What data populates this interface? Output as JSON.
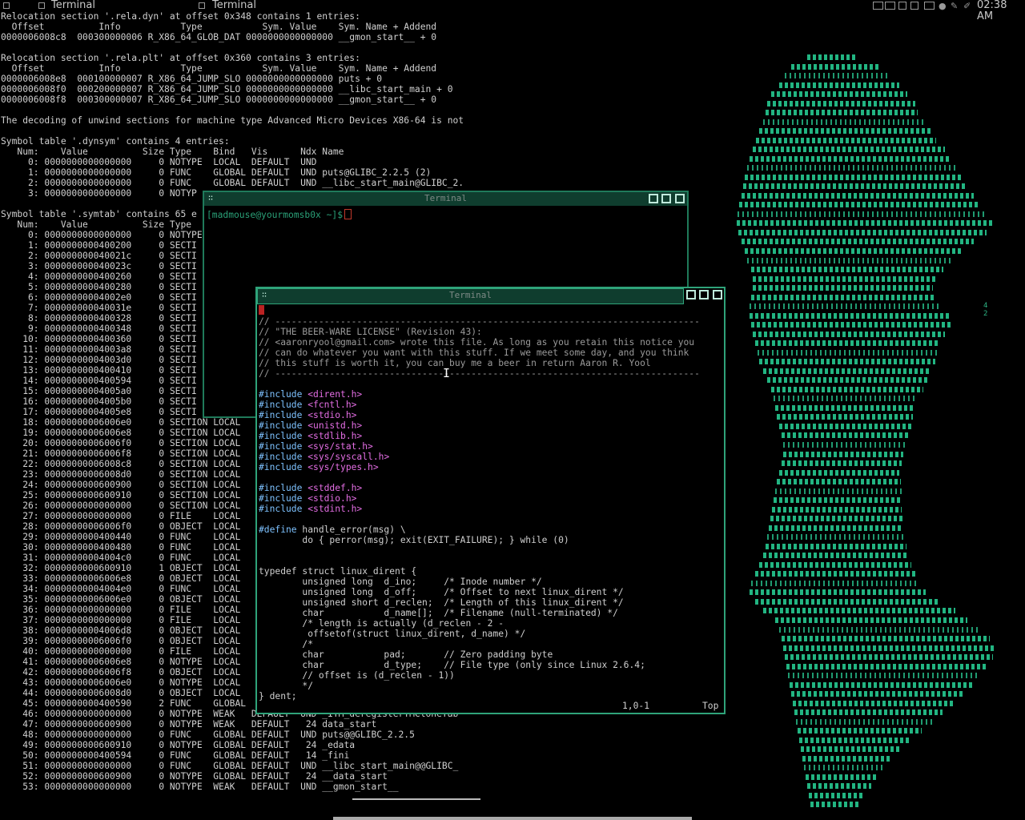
{
  "taskbar": {
    "task1_title": "Terminal",
    "task2_title": "Terminal",
    "clock": "02:38 AM"
  },
  "background_terminal": {
    "lines": [
      "Relocation section '.rela.dyn' at offset 0x348 contains 1 entries:",
      "  Offset          Info           Type           Sym. Value    Sym. Name + Addend",
      "0000006008c8  000300000006 R_X86_64_GLOB_DAT 0000000000000000 __gmon_start__ + 0",
      "",
      "Relocation section '.rela.plt' at offset 0x360 contains 3 entries:",
      "  Offset          Info           Type           Sym. Value    Sym. Name + Addend",
      "0000006008e8  000100000007 R_X86_64_JUMP_SLO 0000000000000000 puts + 0",
      "0000006008f0  000200000007 R_X86_64_JUMP_SLO 0000000000000000 __libc_start_main + 0",
      "0000006008f8  000300000007 R_X86_64_JUMP_SLO 0000000000000000 __gmon_start__ + 0",
      "",
      "The decoding of unwind sections for machine type Advanced Micro Devices X86-64 is not",
      "",
      "Symbol table '.dynsym' contains 4 entries:",
      "   Num:    Value          Size Type    Bind   Vis      Ndx Name",
      "     0: 0000000000000000     0 NOTYPE  LOCAL  DEFAULT  UND",
      "     1: 0000000000000000     0 FUNC    GLOBAL DEFAULT  UND puts@GLIBC_2.2.5 (2)",
      "     2: 0000000000000000     0 FUNC    GLOBAL DEFAULT  UND __libc_start_main@GLIBC_2.",
      "     3: 0000000000000000     0 NOTYP",
      "",
      "Symbol table '.symtab' contains 65 e",
      "   Num:    Value          Size Type",
      "     0: 0000000000000000     0 NOTYPE",
      "     1: 0000000000400200     0 SECTI",
      "     2: 000000000040021c     0 SECTI",
      "     3: 000000000040023c     0 SECTI",
      "     4: 0000000000400260     0 SECTI",
      "     5: 0000000000400280     0 SECTI",
      "     6: 00000000004002e0     0 SECTI",
      "     7: 000000000040031e     0 SECTI",
      "     8: 0000000000400328     0 SECTI",
      "     9: 0000000000400348     0 SECTI",
      "    10: 0000000000400360     0 SECTI",
      "    11: 00000000004003a8     0 SECTI",
      "    12: 00000000004003d0     0 SECTI",
      "    13: 0000000000400410     0 SECTI",
      "    14: 0000000000400594     0 SECTI",
      "    15: 00000000004005a0     0 SECTI",
      "    16: 00000000004005b0     0 SECTI",
      "    17: 00000000004005e8     0 SECTI",
      "    18: 00000000006006e0     0 SECTION LOCAL",
      "    19: 00000000006006e8     0 SECTION LOCAL",
      "    20: 00000000006006f0     0 SECTION LOCAL",
      "    21: 00000000006006f8     0 SECTION LOCAL",
      "    22: 00000000006008c8     0 SECTION LOCAL",
      "    23: 00000000006008d0     0 SECTION LOCAL",
      "    24: 0000000000600900     0 SECTION LOCAL",
      "    25: 0000000000600910     0 SECTION LOCAL",
      "    26: 0000000000000000     0 SECTION LOCAL",
      "    27: 0000000000000000     0 FILE    LOCAL",
      "    28: 00000000006006f0     0 OBJECT  LOCAL",
      "    29: 0000000000400440     0 FUNC    LOCAL",
      "    30: 0000000000400480     0 FUNC    LOCAL",
      "    31: 00000000004004c0     0 FUNC    LOCAL",
      "    32: 0000000000600910     1 OBJECT  LOCAL",
      "    33: 00000000006006e8     0 OBJECT  LOCAL",
      "    34: 00000000004004e0     0 FUNC    LOCAL",
      "    35: 00000000006006e0     0 OBJECT  LOCAL",
      "    36: 0000000000000000     0 FILE    LOCAL",
      "    37: 0000000000000000     0 FILE    LOCAL",
      "    38: 00000000004006d8     0 OBJECT  LOCAL",
      "    39: 00000000006006f0     0 OBJECT  LOCAL",
      "    40: 0000000000000000     0 FILE    LOCAL",
      "    41: 00000000006006e8     0 NOTYPE  LOCAL",
      "    42: 00000000006006f8     0 OBJECT  LOCAL",
      "    43: 00000000006006e0     0 NOTYPE  LOCAL",
      "    44: 00000000006008d0     0 OBJECT  LOCAL",
      "    45: 0000000000400590     2 FUNC    GLOBAL",
      "    46: 0000000000000000     0 NOTYPE  WEAK   DEFAULT  UND _ITM_deregisterTMCloneTab",
      "    47: 0000000000600900     0 NOTYPE  WEAK   DEFAULT   24 data_start",
      "    48: 0000000000000000     0 FUNC    GLOBAL DEFAULT  UND puts@@GLIBC_2.2.5",
      "    49: 0000000000600910     0 NOTYPE  GLOBAL DEFAULT   24 _edata",
      "    50: 0000000000400594     0 FUNC    GLOBAL DEFAULT   14 _fini",
      "    51: 0000000000000000     0 FUNC    GLOBAL DEFAULT  UND __libc_start_main@@GLIBC_",
      "    52: 0000000000600900     0 NOTYPE  GLOBAL DEFAULT   24 __data_start",
      "    53: 0000000000000000     0 NOTYPE  WEAK   DEFAULT  UND __gmon_start__"
    ]
  },
  "ascii_art": {
    "color": "#22b582",
    "labels": [
      "4",
      "2"
    ]
  },
  "terminal_back": {
    "title": "Terminal",
    "prompt": "[madmouse@yourmomsb0x ~]$"
  },
  "terminal_front": {
    "title": "Terminal",
    "code_lines": [
      {
        "cls": "",
        "text": ""
      },
      {
        "cls": "c-com",
        "text": "// ------------------------------------------------------------------------------"
      },
      {
        "cls": "c-com",
        "text": "// \"THE BEER-WARE LICENSE\" (Revision 43):"
      },
      {
        "cls": "c-com",
        "text": "// <aaronryool@gmail.com> wrote this file. As long as you retain this notice you"
      },
      {
        "cls": "c-com",
        "text": "// can do whatever you want with this stuff. If we meet some day, and you think"
      },
      {
        "cls": "c-com",
        "text": "// this stuff is worth it, you can buy me a beer in return Aaron R. Yool"
      },
      {
        "cls": "c-com",
        "text": "// ------------------------------------------------------------------------------"
      },
      {
        "cls": "",
        "text": ""
      },
      {
        "cls": "inc",
        "pp": "#include",
        "arg": "<dirent.h>"
      },
      {
        "cls": "inc",
        "pp": "#include",
        "arg": "<fcntl.h>"
      },
      {
        "cls": "inc",
        "pp": "#include",
        "arg": "<stdio.h>"
      },
      {
        "cls": "inc",
        "pp": "#include",
        "arg": "<unistd.h>"
      },
      {
        "cls": "inc",
        "pp": "#include",
        "arg": "<stdlib.h>"
      },
      {
        "cls": "inc",
        "pp": "#include",
        "arg": "<sys/stat.h>"
      },
      {
        "cls": "inc",
        "pp": "#include",
        "arg": "<sys/syscall.h>"
      },
      {
        "cls": "inc",
        "pp": "#include",
        "arg": "<sys/types.h>"
      },
      {
        "cls": "",
        "text": ""
      },
      {
        "cls": "inc",
        "pp": "#include",
        "arg": "<stddef.h>"
      },
      {
        "cls": "inc",
        "pp": "#include",
        "arg": "<stdio.h>"
      },
      {
        "cls": "inc",
        "pp": "#include",
        "arg": "<stdint.h>"
      },
      {
        "cls": "",
        "text": ""
      },
      {
        "cls": "def",
        "pp": "#define",
        "arg": " handle_error(msg) \\"
      },
      {
        "cls": "",
        "text": "        do { perror(msg); exit(EXIT_FAILURE); } while (0)"
      },
      {
        "cls": "",
        "text": ""
      },
      {
        "cls": "",
        "text": ""
      },
      {
        "cls": "",
        "text": "typedef struct linux_dirent {"
      },
      {
        "cls": "",
        "text": "        unsigned long  d_ino;     /* Inode number */"
      },
      {
        "cls": "",
        "text": "        unsigned long  d_off;     /* Offset to next linux_dirent */"
      },
      {
        "cls": "",
        "text": "        unsigned short d_reclen;  /* Length of this linux_dirent */"
      },
      {
        "cls": "",
        "text": "        char           d_name[];  /* Filename (null-terminated) */"
      },
      {
        "cls": "",
        "text": "        /* length is actually (d_reclen - 2 -"
      },
      {
        "cls": "",
        "text": "         offsetof(struct linux_dirent, d_name) */"
      },
      {
        "cls": "",
        "text": "        /*"
      },
      {
        "cls": "",
        "text": "        char           pad;       // Zero padding byte"
      },
      {
        "cls": "",
        "text": "        char           d_type;    // File type (only since Linux 2.6.4;"
      },
      {
        "cls": "",
        "text": "        // offset is (d_reclen - 1))"
      },
      {
        "cls": "",
        "text": "        */"
      },
      {
        "cls": "",
        "text": "} dent;"
      }
    ],
    "status_position": "1,0-1",
    "status_scroll": "Top"
  }
}
